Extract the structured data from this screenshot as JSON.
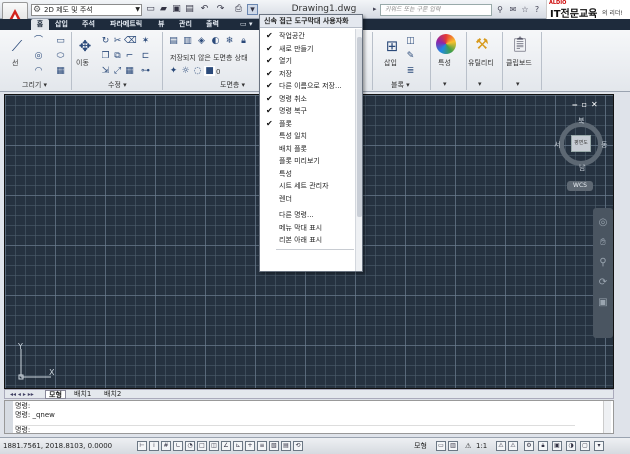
{
  "titlebar": {
    "workspace": "2D 제도 및 주석",
    "document_title": "Drawing1.dwg",
    "search_placeholder": "키워드 또는 구문 입력",
    "brand_small": "ALDIO",
    "brand_name": "IT전문교육",
    "brand_tag": "의 리더!"
  },
  "tabs": [
    "홈",
    "삽입",
    "주석",
    "파라메트릭",
    "뷰",
    "관리",
    "출력"
  ],
  "ribbon": {
    "panels": [
      "그리기 ▾",
      "수정 ▾",
      "도면층 ▾",
      "블록 ▾"
    ],
    "draw_labels": [
      "선"
    ],
    "modify_labels": [
      "이동"
    ],
    "layer_text": "저장되지 않은 도면층 상태",
    "layer_value": "0",
    "block_labels": [
      "삽입"
    ],
    "right_labels": [
      "특성",
      "유틸리티",
      "클립보드"
    ]
  },
  "menu": {
    "title": "신속 접근 도구막대 사용자화",
    "items": [
      {
        "label": "작업공간",
        "checked": true
      },
      {
        "label": "새로 만들기",
        "checked": true
      },
      {
        "label": "열기",
        "checked": true
      },
      {
        "label": "저장",
        "checked": true
      },
      {
        "label": "다른 이름으로 저장...",
        "checked": true
      },
      {
        "label": "명령 취소",
        "checked": true
      },
      {
        "label": "명령 복구",
        "checked": true
      },
      {
        "label": "플롯",
        "checked": true
      },
      {
        "label": "특성 일치",
        "checked": false
      },
      {
        "label": "배치 플롯",
        "checked": false
      },
      {
        "label": "플롯 미리보기",
        "checked": false
      },
      {
        "label": "특성",
        "checked": false
      },
      {
        "label": "시트 세트 관리자",
        "checked": false
      },
      {
        "label": "렌더",
        "checked": false
      },
      {
        "label": "다른 명령...",
        "checked": false
      },
      {
        "label": "메뉴 막대 표시",
        "checked": false
      },
      {
        "label": "리본 아래 표시",
        "checked": false
      }
    ]
  },
  "viewcube": {
    "north": "북",
    "south": "남",
    "east": "동",
    "west": "서",
    "face": "평면도",
    "wcs": "WCS"
  },
  "ucs": {
    "y": "Y",
    "x": "X"
  },
  "layout_tabs": [
    "모형",
    "배치1",
    "배치2"
  ],
  "command": {
    "lines": [
      "명령:",
      "명령: _qnew"
    ],
    "prompt": "명령:"
  },
  "status": {
    "coords": "1881.7561, 2018.8103, 0.0000",
    "model": "모형",
    "scale": "1:1"
  }
}
